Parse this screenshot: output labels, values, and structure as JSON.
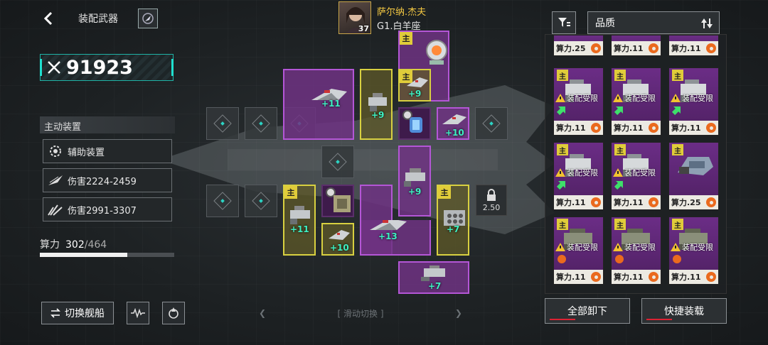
{
  "header": {
    "title": "装配武器"
  },
  "power": {
    "value": "91923"
  },
  "pilot": {
    "name": "萨尔纳.杰夫",
    "zodiac": "G1.白羊座",
    "level": "37"
  },
  "left_panel": {
    "section_label": "主动装置",
    "rows": [
      {
        "label": "辅助装置",
        "icon": "gear-ring-icon"
      },
      {
        "label": "伤害2224-2459",
        "icon": "blade-icon"
      },
      {
        "label": "伤害2991-3307",
        "icon": "scatter-icon"
      }
    ],
    "compute_label": "算力",
    "compute_current": "302",
    "compute_max": "/464",
    "compute_fraction": 0.651
  },
  "bottom_left": {
    "switch_ship_label": "切换舰船"
  },
  "grid": {
    "main_badge": "主",
    "levels": [
      "+11",
      "+9",
      "+9",
      "+10",
      "+9",
      "+11",
      "+10",
      "+13",
      "+7",
      "+7"
    ],
    "lock_value": "2.50",
    "swipe_label": "滑动切换"
  },
  "right_panel": {
    "sort_label": "品质",
    "top_row": [
      "算力.25",
      "算力.11",
      "算力.11"
    ],
    "cards": [
      {
        "foot": "算力.11",
        "warn": "装配受限",
        "main": "主"
      },
      {
        "foot": "算力.11",
        "warn": "装配受限",
        "main": "主"
      },
      {
        "foot": "算力.11",
        "warn": "装配受限",
        "main": "主"
      },
      {
        "foot": "算力.11",
        "warn": "装配受限",
        "main": "主"
      },
      {
        "foot": "算力.11",
        "warn": "装配受限",
        "main": "主"
      },
      {
        "foot": "算力.25",
        "warn": "",
        "main": "主"
      },
      {
        "foot": "算力.11",
        "warn": "装配受限",
        "main": "主"
      },
      {
        "foot": "算力.11",
        "warn": "装配受限",
        "main": "主"
      },
      {
        "foot": "算力.11",
        "warn": "装配受限",
        "main": "主"
      }
    ],
    "unequip_all_label": "全部卸下",
    "quick_equip_label": "快捷装载"
  },
  "colors": {
    "accent_teal": "#1fb3a6",
    "module_purple": "#b456d6",
    "module_yellow": "#d8d040",
    "level_green": "#3df0c2",
    "pilot_gold": "#f4c842",
    "gear_orange": "#ea6a1e"
  }
}
